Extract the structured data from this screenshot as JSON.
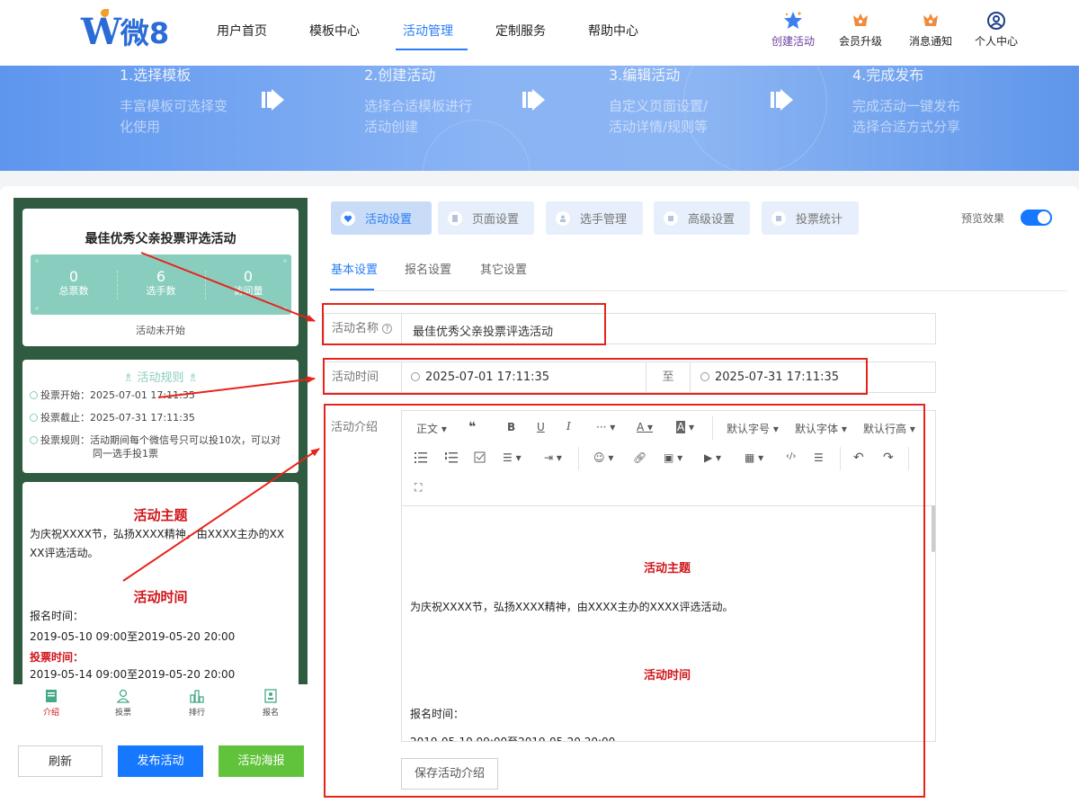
{
  "logo": {
    "text": "微8"
  },
  "nav": {
    "items": [
      {
        "label": "用户首页"
      },
      {
        "label": "模板中心"
      },
      {
        "label": "活动管理"
      },
      {
        "label": "定制服务"
      },
      {
        "label": "帮助中心"
      }
    ],
    "active": "活动管理",
    "utils": [
      {
        "label": "创建活动",
        "icon": "star-icon"
      },
      {
        "label": "会员升级",
        "icon": "crown-icon"
      },
      {
        "label": "消息通知",
        "icon": "bell-icon"
      },
      {
        "label": "个人中心",
        "icon": "user-icon"
      }
    ]
  },
  "banner": {
    "steps": [
      {
        "title": "1.选择模板",
        "desc": "丰富模板可选择变化使用"
      },
      {
        "title": "2.创建活动",
        "desc": "选择合适模板进行活动创建"
      },
      {
        "title": "3.编辑活动",
        "desc": "自定义页面设置/活动详情/规则等"
      },
      {
        "title": "4.完成发布",
        "desc": "完成活动一键发布选择合适方式分享"
      }
    ]
  },
  "preview": {
    "title": "最佳优秀父亲投票评选活动",
    "stats": [
      {
        "value": "0",
        "label": "总票数"
      },
      {
        "value": "6",
        "label": "选手数"
      },
      {
        "value": "0",
        "label": "访问量"
      }
    ],
    "status": "活动未开始",
    "rules_title": "活动规则",
    "rules": [
      {
        "text": "投票开始：2025-07-01 17:11:35"
      },
      {
        "text": "投票截止：2025-07-31 17:11:35"
      },
      {
        "text": "投票规则：活动期间每个微信号只可以投10次，可以对",
        "cont": "同一选手投1票"
      }
    ],
    "intro": {
      "heading1": "活动主题",
      "para1_line1": "为庆祝XXXX节，弘扬XXXX精神，由XXXX主办的XX",
      "para1_line2": "XX评选活动。",
      "heading2": "活动时间",
      "signup_label": "报名时间：",
      "signup_time": "2019-05-10 09:00至2019-05-20 20:00",
      "vote_label": "投票时间：",
      "vote_time": "2019-05-14 09:00至2019-05-20 20:00"
    },
    "tabs": [
      {
        "label": "介绍",
        "icon": "document-icon"
      },
      {
        "label": "投票",
        "icon": "user-icon"
      },
      {
        "label": "排行",
        "icon": "ranking-icon"
      },
      {
        "label": "报名",
        "icon": "form-icon"
      }
    ]
  },
  "actions": {
    "refresh": "刷新",
    "publish": "发布活动",
    "poster": "活动海报"
  },
  "main_tabs": [
    {
      "label": "活动设置",
      "icon": "heart-icon"
    },
    {
      "label": "页面设置",
      "icon": "page-icon"
    },
    {
      "label": "选手管理",
      "icon": "player-icon"
    },
    {
      "label": "高级设置",
      "icon": "advanced-icon"
    },
    {
      "label": "投票统计",
      "icon": "stats-icon"
    }
  ],
  "preview_toggle": {
    "label": "预览效果",
    "on": true
  },
  "sub_tabs": [
    {
      "label": "基本设置"
    },
    {
      "label": "报名设置"
    },
    {
      "label": "其它设置"
    }
  ],
  "form": {
    "name_label": "活动名称",
    "name_value": "最佳优秀父亲投票评选活动",
    "time_label": "活动时间",
    "start": "2025-07-01 17:11:35",
    "to": "至",
    "end": "2025-07-31 17:11:35",
    "intro_label": "活动介绍"
  },
  "editor": {
    "toolbar": {
      "para": "正文",
      "quote": "❝",
      "bold": "B",
      "underline": "U",
      "italic": "I",
      "more": "···",
      "font_color": "A",
      "bg_color": "A",
      "font_size": "默认字号",
      "font_family": "默认字体",
      "line_height": "默认行高"
    },
    "content": {
      "heading1": "活动主题",
      "para1": "为庆祝XXXX节，弘扬XXXX精神，由XXXX主办的XXXX评选活动。",
      "heading2": "活动时间",
      "signup_label": "报名时间：",
      "signup_time": "2019-05-10 09:00至2019-05-20 20:00"
    },
    "save": "保存活动介绍"
  },
  "colors": {
    "primary": "#1677ff",
    "accent": "#2a7cf6",
    "highlight": "#e7231b",
    "phone_bg": "#2f5b41",
    "stats_bg": "#89cdbe",
    "poster": "#61c33c"
  }
}
